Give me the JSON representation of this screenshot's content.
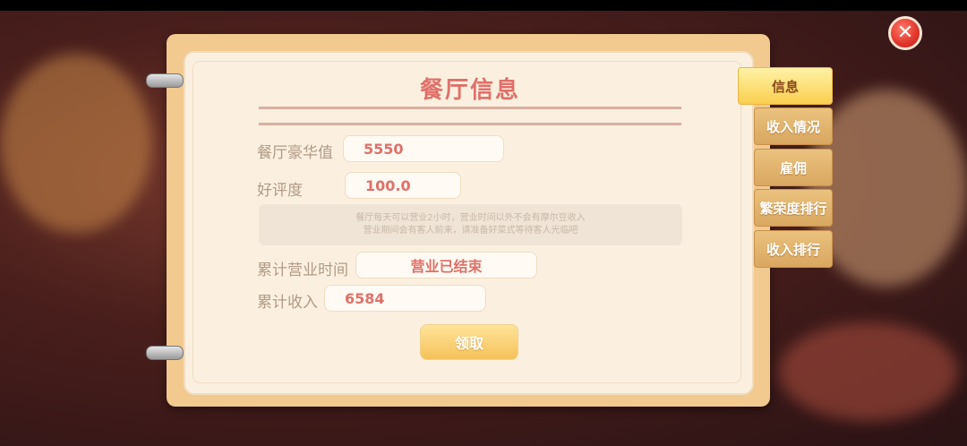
{
  "window": {
    "title": "餐厅信息"
  },
  "close_icon": "close-icon",
  "tabs": [
    {
      "label": "信息",
      "active": true
    },
    {
      "label": "收入情况",
      "active": false
    },
    {
      "label": "雇佣",
      "active": false
    },
    {
      "label": "繁荣度排行",
      "active": false
    },
    {
      "label": "收入排行",
      "active": false
    }
  ],
  "fields": {
    "luxury": {
      "label": "餐厅豪华值",
      "value": "5550"
    },
    "rating": {
      "label": "好评度",
      "value": "100.0"
    },
    "business_time": {
      "label": "累计营业时间",
      "value": "营业已结束"
    },
    "income": {
      "label": "累计收入",
      "value": "6584"
    }
  },
  "notice": {
    "line1": "餐厅每天可以营业2小时，营业时间以外不会有摩尔豆收入",
    "line2": "营业期间会有客人前来，请准备好菜式等待客人光临吧"
  },
  "claim_button": "领取",
  "colors": {
    "accent": "#e0706a",
    "tab_active": "#f9cf4e",
    "tab": "#d9a760"
  }
}
